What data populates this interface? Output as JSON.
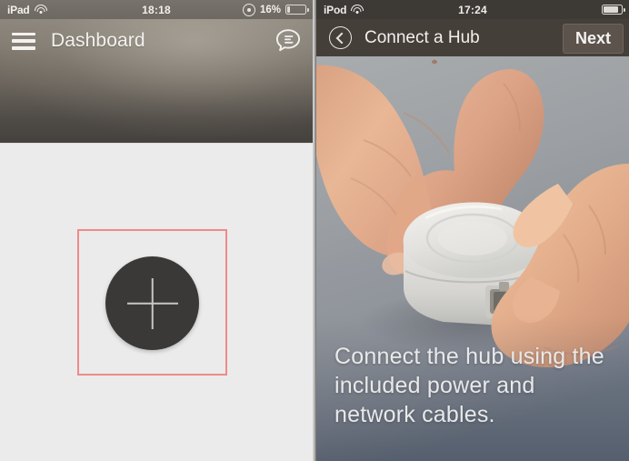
{
  "left_screen": {
    "status_bar": {
      "carrier": "iPad",
      "wifi_icon": "wifi-icon",
      "time": "18:18",
      "rotation_lock_icon": "rotation-lock-icon",
      "battery_percent": "16%",
      "battery_icon": "battery-icon",
      "battery_level": 16
    },
    "header": {
      "menu_icon": "hamburger-menu-icon",
      "title": "Dashboard",
      "chat_icon": "chat-bubble-icon"
    },
    "content": {
      "add_button_icon": "plus-icon",
      "highlight_color": "#f08a8a",
      "add_button_color": "#3b3937",
      "background_color": "#ebebeb"
    }
  },
  "right_screen": {
    "status_bar": {
      "carrier": "iPod",
      "wifi_icon": "wifi-icon",
      "time": "17:24",
      "battery_icon": "battery-icon",
      "battery_level": 80
    },
    "header": {
      "back_icon": "back-chevron-icon",
      "title": "Connect a Hub",
      "next_label": "Next"
    },
    "content": {
      "photo_description": "two-hands-connecting-cable-to-white-hub",
      "caption": "Connect the hub using the included power and network cables."
    }
  }
}
